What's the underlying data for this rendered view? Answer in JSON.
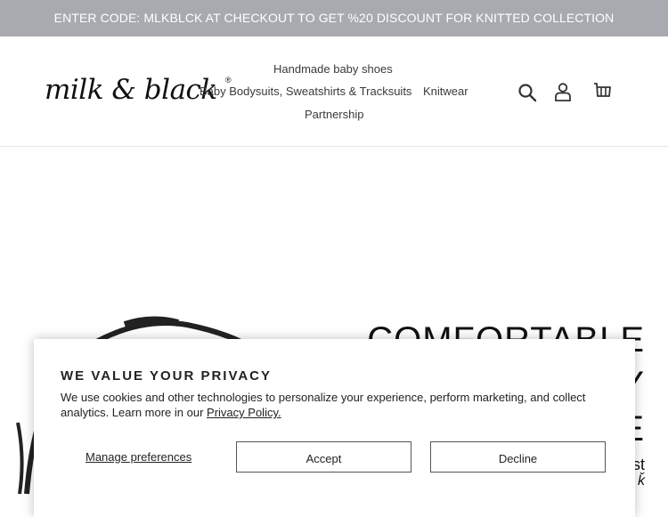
{
  "announcement": "ENTER CODE: MLKBLCK AT CHECKOUT TO GET %20 DISCOUNT FOR KNITTED COLLECTION",
  "logo": {
    "text": "milk & black",
    "mark": "®"
  },
  "nav": {
    "items": [
      "Handmade baby shoes",
      "Baby Bodysuits, Sweatshirts & Tracksuits",
      "Knitwear",
      "Partnership"
    ]
  },
  "header_icons": [
    "search-icon",
    "account-icon",
    "cart-icon"
  ],
  "hero": {
    "line1": "COMFORTABLE",
    "line2": "Y",
    "line3": "E",
    "line4": "st",
    "line5": "ǩ"
  },
  "cookie": {
    "title": "WE VALUE YOUR PRIVACY",
    "body": "We use cookies and other technologies to personalize your experience, perform marketing, and collect analytics. Learn more in our",
    "link": "Privacy Policy.",
    "manage": "Manage preferences",
    "accept": "Accept",
    "decline": "Decline"
  },
  "colors": {
    "announcement_bg": "#a8aab0",
    "text": "#3a3a3a"
  }
}
